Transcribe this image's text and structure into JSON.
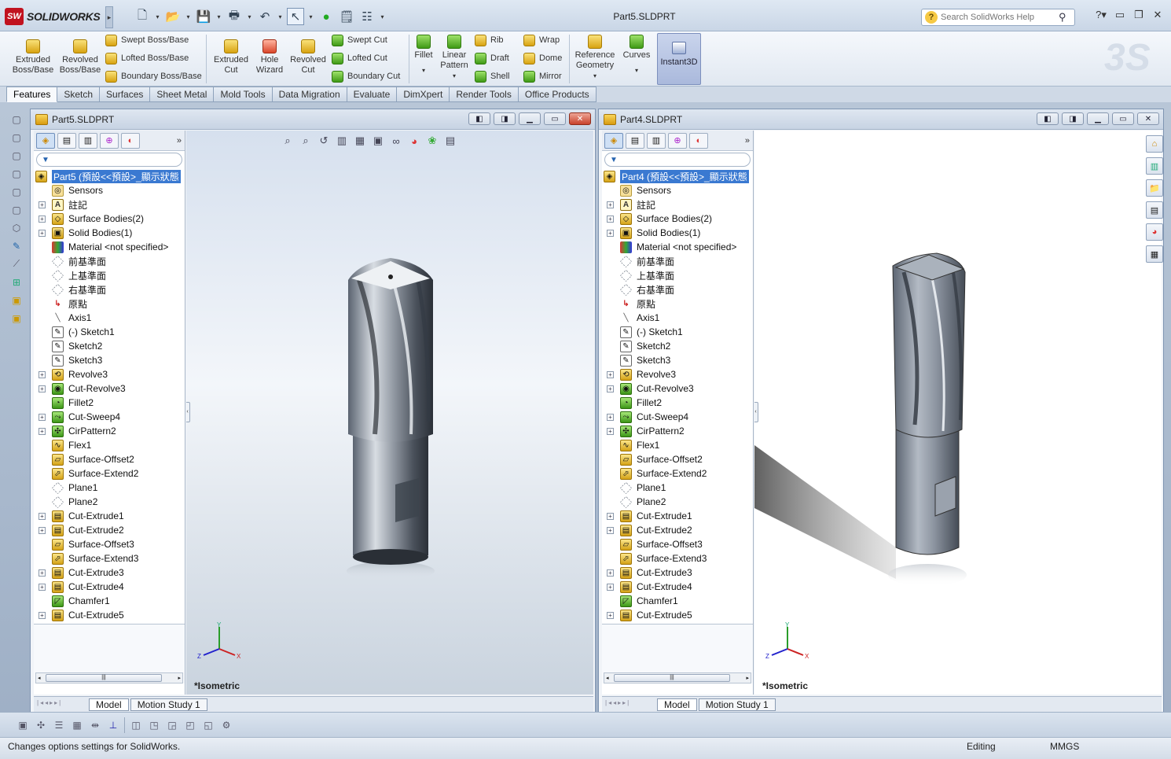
{
  "app": {
    "logo_text": "SOLIDWORKS",
    "logo_mark": "SW",
    "title": "Part5.SLDPRT"
  },
  "help": {
    "placeholder": "Search SolidWorks Help"
  },
  "commands": {
    "extruded_boss": "Extruded Boss/Base",
    "revolved_boss": "Revolved Boss/Base",
    "swept_boss": "Swept Boss/Base",
    "lofted_boss": "Lofted Boss/Base",
    "boundary_boss": "Boundary Boss/Base",
    "extruded_cut": "Extruded Cut",
    "hole_wizard": "Hole Wizard",
    "revolved_cut": "Revolved Cut",
    "swept_cut": "Swept Cut",
    "lofted_cut": "Lofted Cut",
    "boundary_cut": "Boundary Cut",
    "fillet": "Fillet",
    "linear_pattern": "Linear Pattern",
    "rib": "Rib",
    "draft": "Draft",
    "shell": "Shell",
    "wrap": "Wrap",
    "dome": "Dome",
    "mirror": "Mirror",
    "reference_geometry": "Reference Geometry",
    "curves": "Curves",
    "instant3d": "Instant3D"
  },
  "tabs": [
    "Features",
    "Sketch",
    "Surfaces",
    "Sheet Metal",
    "Mold Tools",
    "Data Migration",
    "Evaluate",
    "DimXpert",
    "Render Tools",
    "Office Products"
  ],
  "windows": [
    {
      "title": "Part5.SLDPRT",
      "root": "Part5  (預設<<預設>_顯示狀態",
      "view": "*Isometric",
      "tabs": [
        "Model",
        "Motion Study 1"
      ]
    },
    {
      "title": "Part4.SLDPRT",
      "root": "Part4  (預設<<預設>_顯示狀態",
      "view": "*Isometric",
      "tabs": [
        "Model",
        "Motion Study 1"
      ]
    }
  ],
  "tree_items": [
    {
      "label": "Sensors",
      "icon": "sensors-icon",
      "exp": false
    },
    {
      "label": "註記",
      "icon": "annotations-icon",
      "exp": true
    },
    {
      "label": "Surface Bodies(2)",
      "icon": "surface-bodies-icon",
      "exp": true
    },
    {
      "label": "Solid Bodies(1)",
      "icon": "solid-bodies-icon",
      "exp": true
    },
    {
      "label": "Material <not specified>",
      "icon": "material-icon",
      "exp": false
    },
    {
      "label": "前基準面",
      "icon": "plane-icon",
      "exp": false
    },
    {
      "label": "上基準面",
      "icon": "plane-icon",
      "exp": false
    },
    {
      "label": "右基準面",
      "icon": "plane-icon",
      "exp": false
    },
    {
      "label": "原點",
      "icon": "origin-icon",
      "exp": false
    },
    {
      "label": "Axis1",
      "icon": "axis-icon",
      "exp": false
    },
    {
      "label": "(-) Sketch1",
      "icon": "sketch-icon",
      "exp": false
    },
    {
      "label": "Sketch2",
      "icon": "sketch-icon",
      "exp": false
    },
    {
      "label": "Sketch3",
      "icon": "sketch-icon",
      "exp": false
    },
    {
      "label": "Revolve3",
      "icon": "revolve-icon",
      "exp": true
    },
    {
      "label": "Cut-Revolve3",
      "icon": "cut-revolve-icon",
      "exp": true
    },
    {
      "label": "Fillet2",
      "icon": "fillet-icon",
      "exp": false
    },
    {
      "label": "Cut-Sweep4",
      "icon": "cut-sweep-icon",
      "exp": true
    },
    {
      "label": "CirPattern2",
      "icon": "circular-pattern-icon",
      "exp": true
    },
    {
      "label": "Flex1",
      "icon": "flex-icon",
      "exp": false
    },
    {
      "label": "Surface-Offset2",
      "icon": "surface-offset-icon",
      "exp": false
    },
    {
      "label": "Surface-Extend2",
      "icon": "surface-extend-icon",
      "exp": false
    },
    {
      "label": "Plane1",
      "icon": "plane-icon",
      "exp": false
    },
    {
      "label": "Plane2",
      "icon": "plane-icon",
      "exp": false
    },
    {
      "label": "Cut-Extrude1",
      "icon": "cut-extrude-icon",
      "exp": true
    },
    {
      "label": "Cut-Extrude2",
      "icon": "cut-extrude-icon",
      "exp": true
    },
    {
      "label": "Surface-Offset3",
      "icon": "surface-offset-icon",
      "exp": false
    },
    {
      "label": "Surface-Extend3",
      "icon": "surface-extend-icon",
      "exp": false
    },
    {
      "label": "Cut-Extrude3",
      "icon": "cut-extrude-icon",
      "exp": true
    },
    {
      "label": "Cut-Extrude4",
      "icon": "cut-extrude-icon",
      "exp": true
    },
    {
      "label": "Chamfer1",
      "icon": "chamfer-icon",
      "exp": false
    },
    {
      "label": "Cut-Extrude5",
      "icon": "cut-extrude-icon",
      "exp": true
    }
  ],
  "status": {
    "message": "Changes options settings for SolidWorks.",
    "mode": "Editing",
    "units": "MMGS"
  },
  "colors": {
    "accent": "#3a79d1",
    "feature_yellow": "#d5a317",
    "close_red": "#c8412b"
  }
}
